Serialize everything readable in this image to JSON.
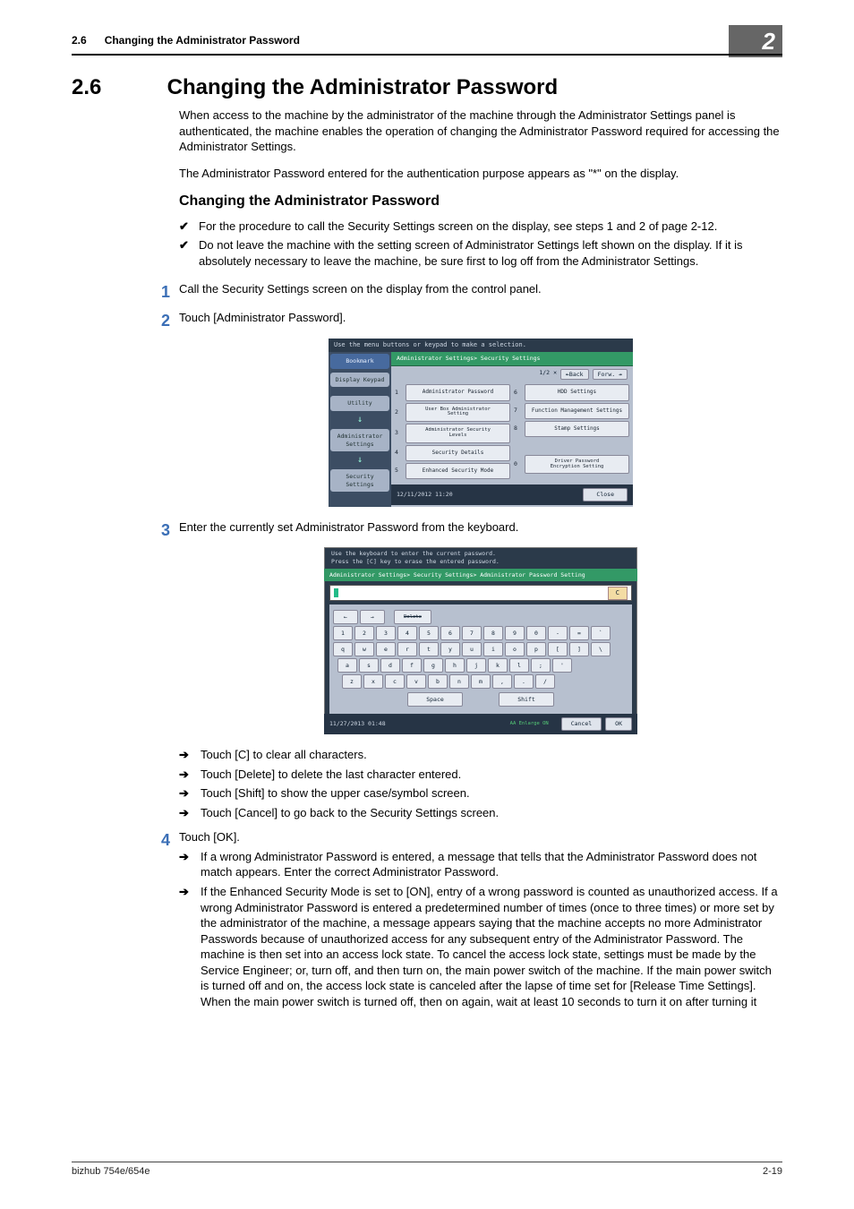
{
  "header": {
    "section_no": "2.6",
    "section_title_short": "Changing the Administrator Password",
    "chapter_no": "2"
  },
  "title": {
    "no": "2.6",
    "text": "Changing the Administrator Password"
  },
  "intro_p1": "When access to the machine by the administrator of the machine through the Administrator Settings panel is authenticated, the machine enables the operation of changing the Administrator Password required for accessing the Administrator Settings.",
  "intro_p2": "The Administrator Password entered for the authentication purpose appears as \"*\" on the display.",
  "subhead": "Changing the Administrator Password",
  "checks": [
    "For the procedure to call the Security Settings screen on the display, see steps 1 and 2 of page 2-12.",
    "Do not leave the machine with the setting screen of Administrator Settings left shown on the display. If it is absolutely necessary to leave the machine, be sure first to log off from the Administrator Settings."
  ],
  "steps": {
    "s1": {
      "num": "1",
      "text": "Call the Security Settings screen on the display from the control panel."
    },
    "s2": {
      "num": "2",
      "text": "Touch [Administrator Password]."
    },
    "s3": {
      "num": "3",
      "text": "Enter the currently set Administrator Password from the keyboard."
    },
    "s3_sub": [
      "Touch [C] to clear all characters.",
      "Touch [Delete] to delete the last character entered.",
      "Touch [Shift] to show the upper case/symbol screen.",
      "Touch [Cancel] to go back to the Security Settings screen."
    ],
    "s4": {
      "num": "4",
      "text": "Touch [OK]."
    },
    "s4_sub": [
      "If a wrong Administrator Password is entered, a message that tells that the Administrator Password does not match appears. Enter the correct Administrator Password.",
      "If the Enhanced Security Mode is set to [ON], entry of a wrong password is counted as unauthorized access. If a wrong Administrator Password is entered a predetermined number of times (once to three times) or more set by the administrator of the machine, a message appears saying that the machine accepts no more Administrator Passwords because of unauthorized access for any subsequent entry of the Administrator Password. The machine is then set into an access lock state. To cancel the access lock state, settings must be made by the Service Engineer; or, turn off, and then turn on, the main power switch of the machine. If the main power switch is turned off and on, the access lock state is canceled after the lapse of time set for [Release Time Settings]. When the main power switch is turned off, then on again, wait at least 10 seconds to turn it on after turning it"
    ]
  },
  "fig1": {
    "top_hint": "Use the menu buttons or keypad to make a selection.",
    "left_tabs": {
      "bookmark": "Bookmark",
      "display_keypad": "Display Keypad",
      "utility": "Utility",
      "admin_settings": "Administrator\nSettings",
      "security_settings": "Security\nSettings"
    },
    "crumb": "Administrator Settings> Security Settings",
    "pager": {
      "page": "1/2",
      "back": "↞Back",
      "fwd": "Forw. ↠"
    },
    "options": {
      "l": [
        {
          "i": "1",
          "t": "Administrator Password"
        },
        {
          "i": "2",
          "t": "User Box Administrator\nSetting"
        },
        {
          "i": "3",
          "t": "Administrator Security\nLevels"
        },
        {
          "i": "4",
          "t": "Security Details"
        },
        {
          "i": "5",
          "t": "Enhanced Security Mode"
        }
      ],
      "r": [
        {
          "i": "6",
          "t": "HDD Settings"
        },
        {
          "i": "7",
          "t": "Function Management Settings"
        },
        {
          "i": "8",
          "t": "Stamp Settings"
        },
        {
          "i": "0",
          "t": "Driver Password\nEncryption Setting"
        }
      ]
    },
    "footer_time": "12/11/2012   11:20",
    "close": "Close"
  },
  "fig2": {
    "hint1": "Use the keyboard to enter the current password.",
    "hint2": "Press the [C] key to erase the entered password.",
    "crumb": "Administrator Settings> Security Settings> Administrator Password Setting",
    "c_btn": "C",
    "del_label": "Delete",
    "rows": {
      "r1": [
        "1",
        "2",
        "3",
        "4",
        "5",
        "6",
        "7",
        "8",
        "9",
        "0",
        "-",
        "=",
        "`"
      ],
      "r2": [
        "q",
        "w",
        "e",
        "r",
        "t",
        "y",
        "u",
        "i",
        "o",
        "p",
        "[",
        "]",
        "\\"
      ],
      "r3": [
        "a",
        "s",
        "d",
        "f",
        "g",
        "h",
        "j",
        "k",
        "l",
        ";",
        "'"
      ],
      "r4": [
        "z",
        "x",
        "c",
        "v",
        "b",
        "n",
        "m",
        ",",
        ".",
        "/"
      ]
    },
    "space": "Space",
    "shift": "Shift",
    "footer_time": "11/27/2013   01:48",
    "enlarge": "AA Enlarge ON",
    "cancel": "Cancel",
    "ok": "OK"
  },
  "footer": {
    "left": "bizhub 754e/654e",
    "right": "2-19"
  }
}
